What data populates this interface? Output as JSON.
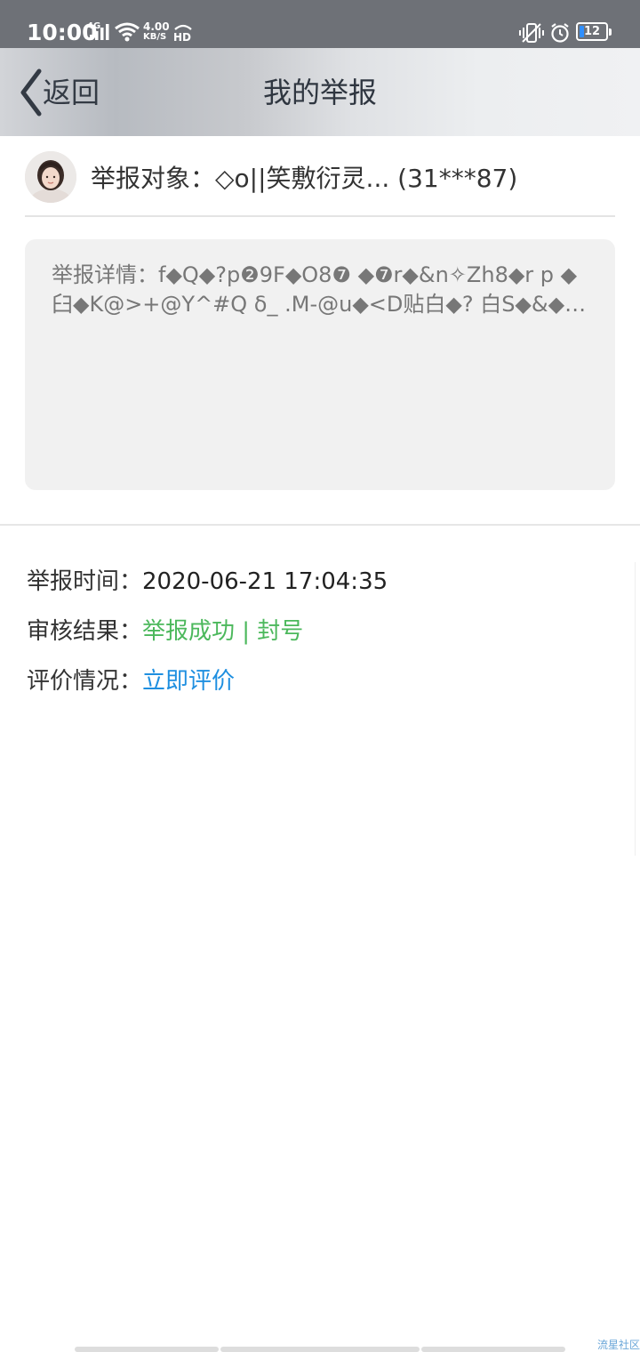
{
  "status_bar": {
    "time": "10:00",
    "network": "4G",
    "speed_value": "4.00",
    "speed_unit": "KB/S",
    "hd": "HD",
    "battery": "12",
    "battery_accent": "#2f8fff"
  },
  "header": {
    "back_label": "返回",
    "title": "我的举报"
  },
  "report": {
    "target_label": "举报对象：",
    "target_value": "◇o||笑敷衍灵... (31***87)",
    "detail_label": "举报详情：",
    "detail_value": "f◆Q◆?p❷9F◆O8❼ ◆❼r◆&n✧Zh8◆r p ◆臼◆K@>+@Y^#Q δ_ .M-@u◆<D贴白◆? 白S◆&◆4❼1◆[..."
  },
  "info": {
    "time_label": "举报时间：",
    "time_value": "2020-06-21 17:04:35",
    "result_label": "审核结果：",
    "result_value": "举报成功 | 封号",
    "result_color": "#4cb85c",
    "rating_label": "评价情况：",
    "rating_link": "立即评价",
    "link_color": "#1e8fe0"
  },
  "watermark": "流星社区"
}
